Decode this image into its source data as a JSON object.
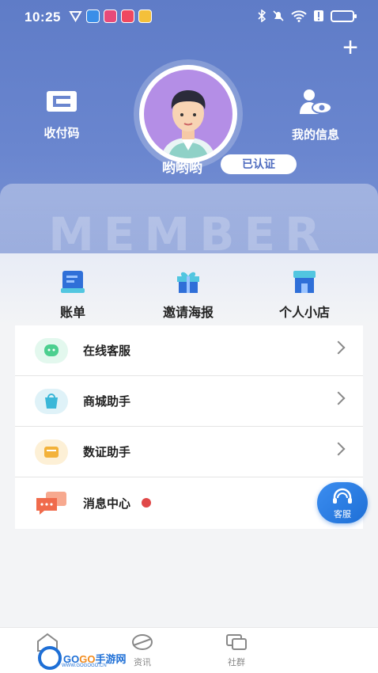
{
  "status_bar": {
    "time": "10:25",
    "left_icons": [
      "shield-icon",
      "app-icon-blue",
      "app-icon-pink",
      "music-icon",
      "app-icon-yellow"
    ],
    "right_icons": [
      "bluetooth-icon",
      "mute-icon",
      "wifi-icon",
      "alert-icon",
      "battery-icon"
    ]
  },
  "header": {
    "add_label": "+",
    "pay_code_label": "收付码",
    "my_info_label": "我的信息",
    "username": "哟哟哟",
    "verified_label": "已认证",
    "member_watermark": "MEMBER"
  },
  "quick_actions": [
    {
      "label": "账单",
      "icon": "bill-icon"
    },
    {
      "label": "邀请海报",
      "icon": "gift-icon"
    },
    {
      "label": "个人小店",
      "icon": "store-icon"
    }
  ],
  "menu": [
    {
      "label": "在线客服",
      "icon": "online-service-icon",
      "color": "#4ccf8f"
    },
    {
      "label": "商城助手",
      "icon": "mall-assistant-icon",
      "color": "#3ab7d8"
    },
    {
      "label": "数证助手",
      "icon": "data-cert-icon",
      "color": "#f3b23a"
    },
    {
      "label": "消息中心",
      "icon": "message-center-icon",
      "color": "#f06b4c"
    }
  ],
  "float_button": {
    "label": "客服"
  },
  "tabbar": [
    {
      "label": "首页",
      "icon": "home-icon"
    },
    {
      "label": "资讯",
      "icon": "news-icon"
    },
    {
      "label": "社群",
      "icon": "community-icon"
    }
  ],
  "watermark": {
    "brand_go1": "GO",
    "brand_go2": "GO",
    "brand_rest": "手游网",
    "url": "WWW.GOGOGO.CN"
  },
  "colors": {
    "header": "#5f7cc7",
    "accent": "#4e6bbf",
    "badge": "#e04848"
  }
}
